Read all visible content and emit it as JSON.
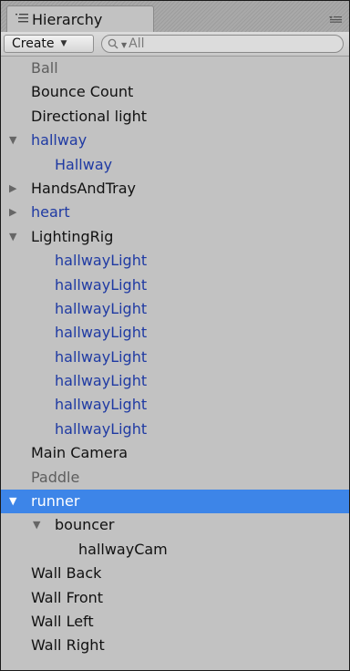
{
  "panel": {
    "tab_title": "Hierarchy",
    "create_label": "Create",
    "search_placeholder": "All"
  },
  "colors": {
    "selection": "#3d85e8",
    "prefab_text": "#1f3aa3",
    "inactive_text": "#5e5e5e"
  },
  "tree": [
    {
      "label": "Ball",
      "depth": 0,
      "arrow": "none",
      "color": "inactive",
      "selected": false
    },
    {
      "label": "Bounce Count",
      "depth": 0,
      "arrow": "none",
      "color": "default",
      "selected": false
    },
    {
      "label": "Directional light",
      "depth": 0,
      "arrow": "none",
      "color": "default",
      "selected": false
    },
    {
      "label": "hallway",
      "depth": 0,
      "arrow": "expanded",
      "color": "prefab",
      "selected": false
    },
    {
      "label": "Hallway",
      "depth": 1,
      "arrow": "none",
      "color": "prefab",
      "selected": false
    },
    {
      "label": "HandsAndTray",
      "depth": 0,
      "arrow": "collapsed",
      "color": "default",
      "selected": false
    },
    {
      "label": "heart",
      "depth": 0,
      "arrow": "collapsed",
      "color": "prefab",
      "selected": false
    },
    {
      "label": "LightingRig",
      "depth": 0,
      "arrow": "expanded",
      "color": "default",
      "selected": false
    },
    {
      "label": "hallwayLight",
      "depth": 1,
      "arrow": "none",
      "color": "prefab",
      "selected": false
    },
    {
      "label": "hallwayLight",
      "depth": 1,
      "arrow": "none",
      "color": "prefab",
      "selected": false
    },
    {
      "label": "hallwayLight",
      "depth": 1,
      "arrow": "none",
      "color": "prefab",
      "selected": false
    },
    {
      "label": "hallwayLight",
      "depth": 1,
      "arrow": "none",
      "color": "prefab",
      "selected": false
    },
    {
      "label": "hallwayLight",
      "depth": 1,
      "arrow": "none",
      "color": "prefab",
      "selected": false
    },
    {
      "label": "hallwayLight",
      "depth": 1,
      "arrow": "none",
      "color": "prefab",
      "selected": false
    },
    {
      "label": "hallwayLight",
      "depth": 1,
      "arrow": "none",
      "color": "prefab",
      "selected": false
    },
    {
      "label": "hallwayLight",
      "depth": 1,
      "arrow": "none",
      "color": "prefab",
      "selected": false
    },
    {
      "label": "Main Camera",
      "depth": 0,
      "arrow": "none",
      "color": "default",
      "selected": false
    },
    {
      "label": "Paddle",
      "depth": 0,
      "arrow": "none",
      "color": "inactive",
      "selected": false
    },
    {
      "label": "runner",
      "depth": 0,
      "arrow": "expanded",
      "color": "default",
      "selected": true
    },
    {
      "label": "bouncer",
      "depth": 1,
      "arrow": "expanded",
      "color": "default",
      "selected": false
    },
    {
      "label": "hallwayCam",
      "depth": 2,
      "arrow": "none",
      "color": "default",
      "selected": false
    },
    {
      "label": "Wall Back",
      "depth": 0,
      "arrow": "none",
      "color": "default",
      "selected": false
    },
    {
      "label": "Wall Front",
      "depth": 0,
      "arrow": "none",
      "color": "default",
      "selected": false
    },
    {
      "label": "Wall Left",
      "depth": 0,
      "arrow": "none",
      "color": "default",
      "selected": false
    },
    {
      "label": "Wall Right",
      "depth": 0,
      "arrow": "none",
      "color": "default",
      "selected": false
    }
  ]
}
